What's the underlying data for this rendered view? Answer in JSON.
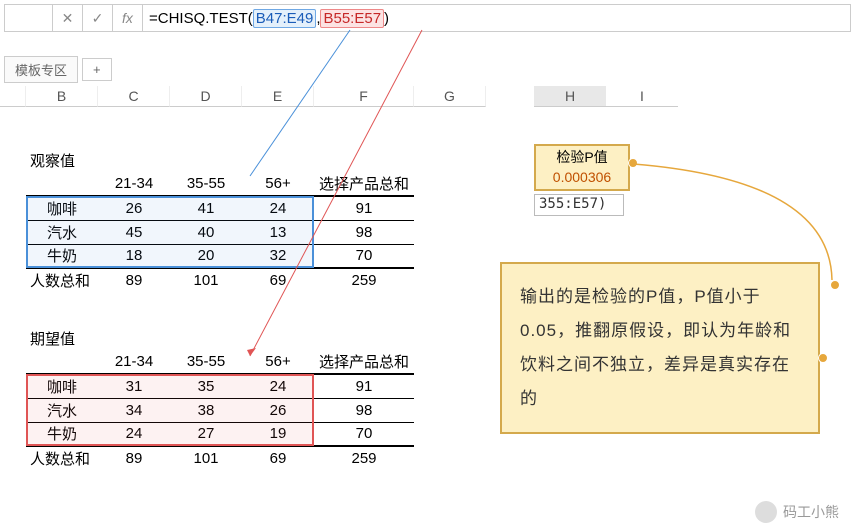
{
  "formula_bar": {
    "cell_ref": "",
    "cancel_icon": "✕",
    "confirm_icon": "✓",
    "fx_icon": "fx",
    "formula_prefix": "=CHISQ.TEST(",
    "range1": "B47:E49",
    "comma": ", ",
    "range2": "B55:E57",
    "formula_suffix": ")"
  },
  "tabs": {
    "main": "模板专区",
    "add": "+"
  },
  "columns": [
    "B",
    "C",
    "D",
    "E",
    "F",
    "G",
    "H",
    "I"
  ],
  "observed": {
    "title": "观察值",
    "headers": [
      "",
      "21-34",
      "35-55",
      "56+",
      "选择产品总和"
    ],
    "rows": [
      {
        "label": "咖啡",
        "v": [
          26,
          41,
          24,
          91
        ]
      },
      {
        "label": "汽水",
        "v": [
          45,
          40,
          13,
          98
        ]
      },
      {
        "label": "牛奶",
        "v": [
          18,
          20,
          32,
          70
        ]
      }
    ],
    "sum": {
      "label": "人数总和",
      "v": [
        89,
        101,
        69,
        259
      ]
    }
  },
  "expected": {
    "title": "期望值",
    "headers": [
      "",
      "21-34",
      "35-55",
      "56+",
      "选择产品总和"
    ],
    "rows": [
      {
        "label": "咖啡",
        "v": [
          31,
          35,
          24,
          91
        ]
      },
      {
        "label": "汽水",
        "v": [
          34,
          38,
          26,
          98
        ]
      },
      {
        "label": "牛奶",
        "v": [
          24,
          27,
          19,
          70
        ]
      }
    ],
    "sum": {
      "label": "人数总和",
      "v": [
        89,
        101,
        69,
        259
      ]
    }
  },
  "pvalue_box": {
    "label": "检验P值",
    "value": "0.000306"
  },
  "editing_cell": "355:E57)",
  "callout_text": "输出的是检验的P值，P值小于0.05，推翻原假设，即认为年龄和饮料之间不独立，差异是真实存在的",
  "footer": "码工小熊",
  "chart_data": {
    "type": "table",
    "title": "Chi-square test data",
    "observed": {
      "row_labels": [
        "咖啡",
        "汽水",
        "牛奶"
      ],
      "col_labels": [
        "21-34",
        "35-55",
        "56+"
      ],
      "matrix": [
        [
          26,
          41,
          24
        ],
        [
          45,
          40,
          13
        ],
        [
          18,
          20,
          32
        ]
      ],
      "row_totals": [
        91,
        98,
        70
      ],
      "col_totals": [
        89,
        101,
        69
      ],
      "grand_total": 259
    },
    "expected": {
      "row_labels": [
        "咖啡",
        "汽水",
        "牛奶"
      ],
      "col_labels": [
        "21-34",
        "35-55",
        "56+"
      ],
      "matrix": [
        [
          31,
          35,
          24
        ],
        [
          34,
          38,
          26
        ],
        [
          24,
          27,
          19
        ]
      ],
      "row_totals": [
        91,
        98,
        70
      ],
      "col_totals": [
        89,
        101,
        69
      ],
      "grand_total": 259
    },
    "p_value": 0.000306
  }
}
